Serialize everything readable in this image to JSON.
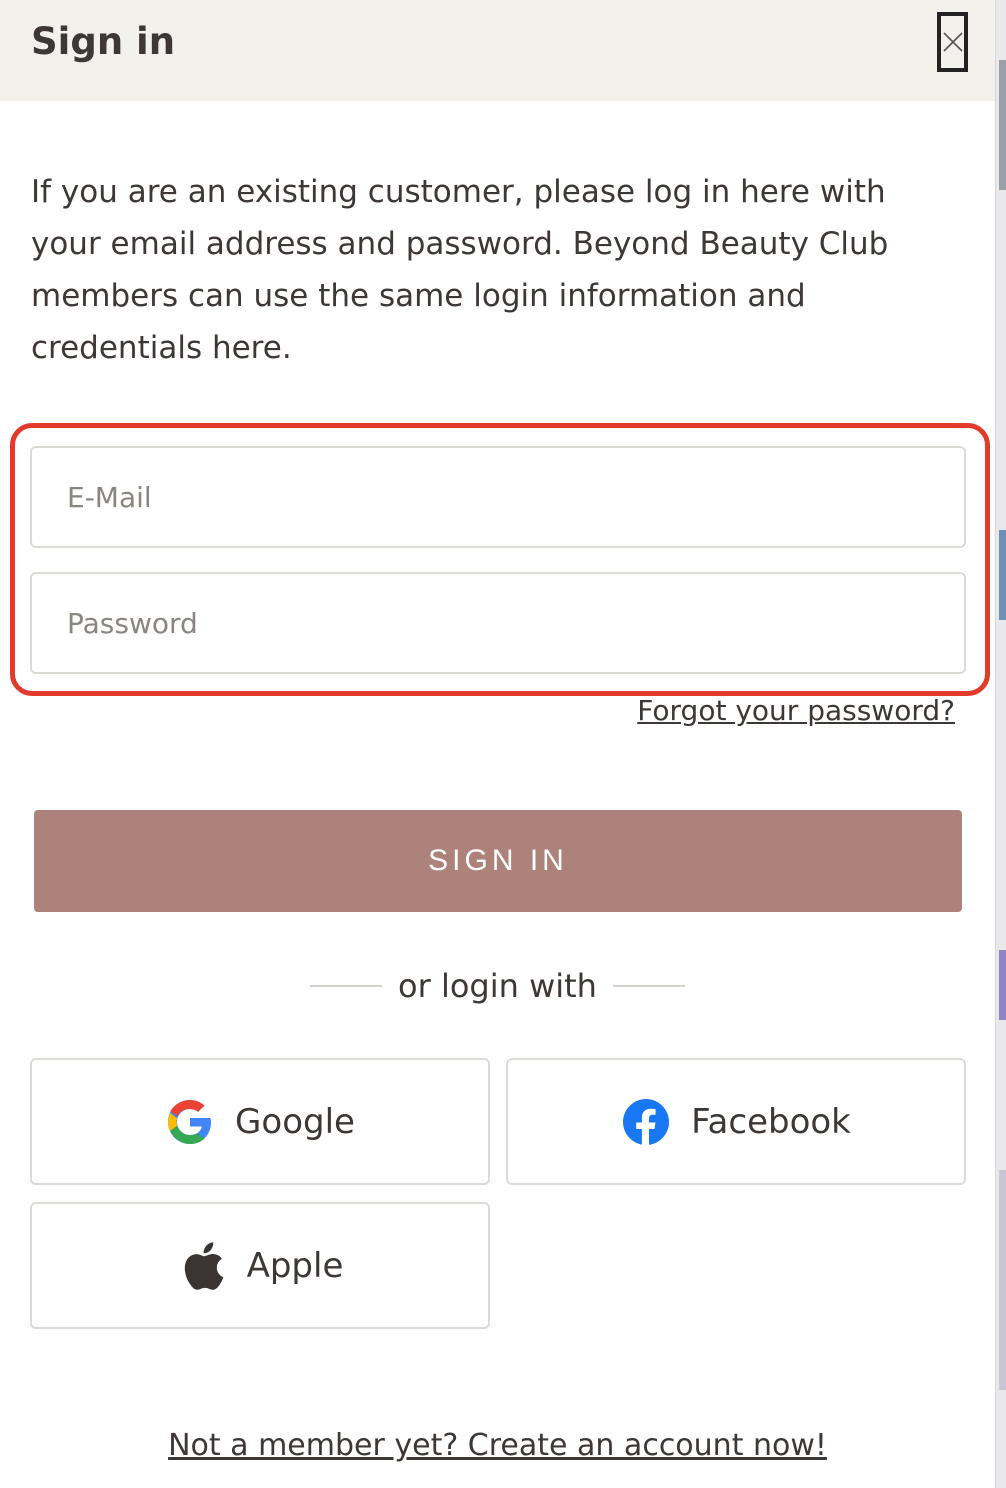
{
  "header": {
    "title": "Sign in",
    "close_icon": "close-icon"
  },
  "intro_text": "If you are an existing customer, please log in here with your email address and password. Beyond Beauty Club members can use the same login information and credentials here.",
  "form": {
    "email_placeholder": "E-Mail",
    "email_value": "",
    "password_placeholder": "Password",
    "password_value": "",
    "forgot_label": "Forgot your password?",
    "submit_label": "SIGN IN"
  },
  "divider_text": "or login with",
  "social": {
    "google_label": "Google",
    "facebook_label": "Facebook",
    "apple_label": "Apple"
  },
  "footer_link": "Not a member yet? Create an account now!",
  "colors": {
    "header_bg": "#f3f1ec",
    "submit_bg": "#ad827a",
    "highlight_border": "#e23b2c",
    "text": "#3d3835"
  }
}
